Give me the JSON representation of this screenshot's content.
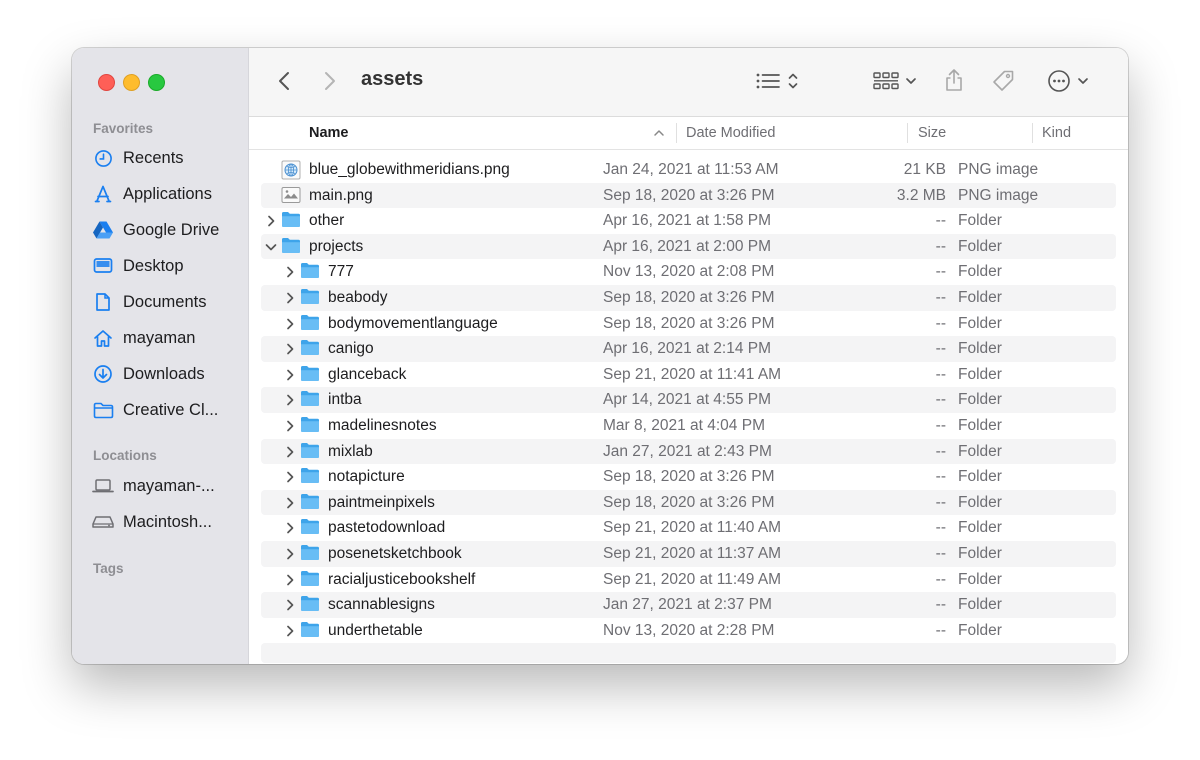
{
  "window": {
    "title": "assets"
  },
  "sidebar": {
    "favorites_label": "Favorites",
    "favorites": [
      {
        "label": "Recents",
        "icon": "clock-icon"
      },
      {
        "label": "Applications",
        "icon": "applications-icon"
      },
      {
        "label": "Google Drive",
        "icon": "google-drive-icon"
      },
      {
        "label": "Desktop",
        "icon": "desktop-icon"
      },
      {
        "label": "Documents",
        "icon": "document-icon"
      },
      {
        "label": "mayaman",
        "icon": "home-icon"
      },
      {
        "label": "Downloads",
        "icon": "download-icon"
      },
      {
        "label": "Creative Cl...",
        "icon": "folder-icon"
      }
    ],
    "locations_label": "Locations",
    "locations": [
      {
        "label": "mayaman-...",
        "icon": "laptop-icon"
      },
      {
        "label": "Macintosh...",
        "icon": "disk-icon"
      }
    ],
    "tags_label": "Tags"
  },
  "columns": {
    "name": "Name",
    "date": "Date Modified",
    "size": "Size",
    "kind": "Kind"
  },
  "files": [
    {
      "name": "blue_globewithmeridians.png",
      "date": "Jan 24, 2021 at 11:53 AM",
      "size": "21 KB",
      "kind": "PNG image",
      "type": "image-globe",
      "level": 0,
      "disclosure": "none"
    },
    {
      "name": "main.png",
      "date": "Sep 18, 2020 at 3:26 PM",
      "size": "3.2 MB",
      "kind": "PNG image",
      "type": "image",
      "level": 0,
      "disclosure": "none"
    },
    {
      "name": "other",
      "date": "Apr 16, 2021 at 1:58 PM",
      "size": "--",
      "kind": "Folder",
      "type": "folder",
      "level": 0,
      "disclosure": "collapsed"
    },
    {
      "name": "projects",
      "date": "Apr 16, 2021 at 2:00 PM",
      "size": "--",
      "kind": "Folder",
      "type": "folder",
      "level": 0,
      "disclosure": "expanded"
    },
    {
      "name": "777",
      "date": "Nov 13, 2020 at 2:08 PM",
      "size": "--",
      "kind": "Folder",
      "type": "folder",
      "level": 1,
      "disclosure": "collapsed"
    },
    {
      "name": "beabody",
      "date": "Sep 18, 2020 at 3:26 PM",
      "size": "--",
      "kind": "Folder",
      "type": "folder",
      "level": 1,
      "disclosure": "collapsed"
    },
    {
      "name": "bodymovementlanguage",
      "date": "Sep 18, 2020 at 3:26 PM",
      "size": "--",
      "kind": "Folder",
      "type": "folder",
      "level": 1,
      "disclosure": "collapsed"
    },
    {
      "name": "canigo",
      "date": "Apr 16, 2021 at 2:14 PM",
      "size": "--",
      "kind": "Folder",
      "type": "folder",
      "level": 1,
      "disclosure": "collapsed"
    },
    {
      "name": "glanceback",
      "date": "Sep 21, 2020 at 11:41 AM",
      "size": "--",
      "kind": "Folder",
      "type": "folder",
      "level": 1,
      "disclosure": "collapsed"
    },
    {
      "name": "intba",
      "date": "Apr 14, 2021 at 4:55 PM",
      "size": "--",
      "kind": "Folder",
      "type": "folder",
      "level": 1,
      "disclosure": "collapsed"
    },
    {
      "name": "madelinesnotes",
      "date": "Mar 8, 2021 at 4:04 PM",
      "size": "--",
      "kind": "Folder",
      "type": "folder",
      "level": 1,
      "disclosure": "collapsed"
    },
    {
      "name": "mixlab",
      "date": "Jan 27, 2021 at 2:43 PM",
      "size": "--",
      "kind": "Folder",
      "type": "folder",
      "level": 1,
      "disclosure": "collapsed"
    },
    {
      "name": "notapicture",
      "date": "Sep 18, 2020 at 3:26 PM",
      "size": "--",
      "kind": "Folder",
      "type": "folder",
      "level": 1,
      "disclosure": "collapsed"
    },
    {
      "name": "paintmeinpixels",
      "date": "Sep 18, 2020 at 3:26 PM",
      "size": "--",
      "kind": "Folder",
      "type": "folder",
      "level": 1,
      "disclosure": "collapsed"
    },
    {
      "name": "pastetodownload",
      "date": "Sep 21, 2020 at 11:40 AM",
      "size": "--",
      "kind": "Folder",
      "type": "folder",
      "level": 1,
      "disclosure": "collapsed"
    },
    {
      "name": "posenetsketchbook",
      "date": "Sep 21, 2020 at 11:37 AM",
      "size": "--",
      "kind": "Folder",
      "type": "folder",
      "level": 1,
      "disclosure": "collapsed"
    },
    {
      "name": "racialjusticebookshelf",
      "date": "Sep 21, 2020 at 11:49 AM",
      "size": "--",
      "kind": "Folder",
      "type": "folder",
      "level": 1,
      "disclosure": "collapsed"
    },
    {
      "name": "scannablesigns",
      "date": "Jan 27, 2021 at 2:37 PM",
      "size": "--",
      "kind": "Folder",
      "type": "folder",
      "level": 1,
      "disclosure": "collapsed"
    },
    {
      "name": "underthetable",
      "date": "Nov 13, 2020 at 2:28 PM",
      "size": "--",
      "kind": "Folder",
      "type": "folder",
      "level": 1,
      "disclosure": "collapsed"
    }
  ],
  "colors": {
    "accent": "#1a7ff0",
    "folder": "#5fb8f4",
    "sidebar_bg": "#e4e4e9"
  }
}
